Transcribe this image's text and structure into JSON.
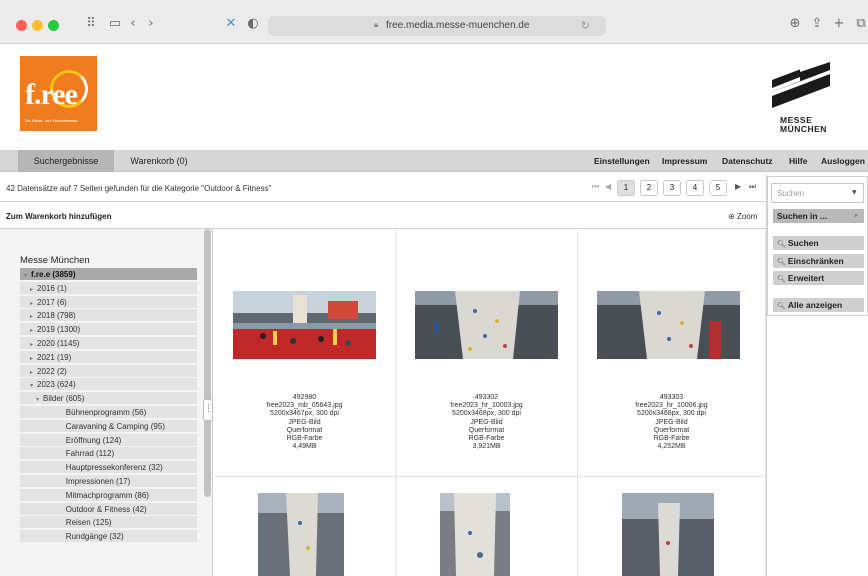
{
  "browser": {
    "url": "free.media.messe-muenchen.de",
    "icons": [
      "sidebar-grid-icon",
      "sidebar-icon",
      "back-icon",
      "forward-icon",
      "extension-icon",
      "shield-icon",
      "lock-icon",
      "reload-icon",
      "download-icon",
      "share-icon",
      "new-tab-icon",
      "tab-overview-icon"
    ]
  },
  "logos": {
    "free_word": "f.ree",
    "free_tagline": "Die Reise- und Freizeitmesse.",
    "messe_line1": "MESSE",
    "messe_line2": "MÜNCHEN"
  },
  "nav": {
    "tab_results": "Suchergebnisse",
    "tab_cart": "Warenkorb (0)",
    "links": [
      "Einstellungen",
      "Impressum",
      "Datenschutz",
      "Hilfe",
      "Ausloggen"
    ]
  },
  "info": {
    "summary": "42 Datensätze auf 7 Seiten gefunden für die Kategorie \"Outdoor & Fitness\"",
    "add_to_cart": "Zum Warenkorb hinzufügen",
    "zoom": "Zoom"
  },
  "pager": {
    "pages": [
      "1",
      "2",
      "3",
      "4",
      "5"
    ],
    "current": "1"
  },
  "tree": {
    "root": "Messe München",
    "nodes": [
      {
        "label": "f.re.e (3859)",
        "level": 0,
        "arrow": "▾",
        "selected": true
      },
      {
        "label": "2016 (1)",
        "level": 1,
        "arrow": "▸"
      },
      {
        "label": "2017 (6)",
        "level": 1,
        "arrow": "▸"
      },
      {
        "label": "2018 (798)",
        "level": 1,
        "arrow": "▸"
      },
      {
        "label": "2019 (1300)",
        "level": 1,
        "arrow": "▸"
      },
      {
        "label": "2020 (1145)",
        "level": 1,
        "arrow": "▸"
      },
      {
        "label": "2021 (19)",
        "level": 1,
        "arrow": "▸"
      },
      {
        "label": "2022 (2)",
        "level": 1,
        "arrow": "▸"
      },
      {
        "label": "2023 (624)",
        "level": 1,
        "arrow": "▾"
      },
      {
        "label": "Bilder (605)",
        "level": 2,
        "arrow": "▾"
      },
      {
        "label": "Bühnenprogramm (56)",
        "level": 3,
        "arrow": ""
      },
      {
        "label": "Caravaning & Camping (95)",
        "level": 3,
        "arrow": ""
      },
      {
        "label": "Eröffnung (124)",
        "level": 3,
        "arrow": ""
      },
      {
        "label": "Fahrrad (112)",
        "level": 3,
        "arrow": ""
      },
      {
        "label": "Hauptpressekonferenz (32)",
        "level": 3,
        "arrow": ""
      },
      {
        "label": "Impressionen (17)",
        "level": 3,
        "arrow": ""
      },
      {
        "label": "Mitmachprogramm (86)",
        "level": 3,
        "arrow": ""
      },
      {
        "label": "Outdoor & Fitness (42)",
        "level": 3,
        "arrow": ""
      },
      {
        "label": "Reisen (125)",
        "level": 3,
        "arrow": ""
      },
      {
        "label": "Rundgänge (32)",
        "level": 3,
        "arrow": ""
      }
    ]
  },
  "results": [
    {
      "id": "492980",
      "file": "free2023_mb_05643.jpg",
      "size": "5200x3467px, 300 dpi",
      "type": "JPEG-Bild",
      "format": "Querformat",
      "color": "RGB-Farbe",
      "filesize": "4,49MB"
    },
    {
      "id": "493302",
      "file": "free2023_hr_10003.jpg",
      "size": "5200x3468px, 300 dpi",
      "type": "JPEG-Bild",
      "format": "Querformat",
      "color": "RGB-Farbe",
      "filesize": "3,921MB"
    },
    {
      "id": "493303",
      "file": "free2023_hr_10006.jpg",
      "size": "5200x3468px, 300 dpi",
      "type": "JPEG-Bild",
      "format": "Querformat",
      "color": "RGB-Farbe",
      "filesize": "4,252MB"
    }
  ],
  "search": {
    "placeholder": "Suchen",
    "search_in": "Suchen in ...",
    "buttons": [
      "Suchen",
      "Einschränken",
      "Erweitert",
      "Alle anzeigen"
    ]
  },
  "colors": {
    "free_orange": "#ef7c1e",
    "nav_grey": "#d6d6d6",
    "selected_grey": "#a9a9a9"
  }
}
